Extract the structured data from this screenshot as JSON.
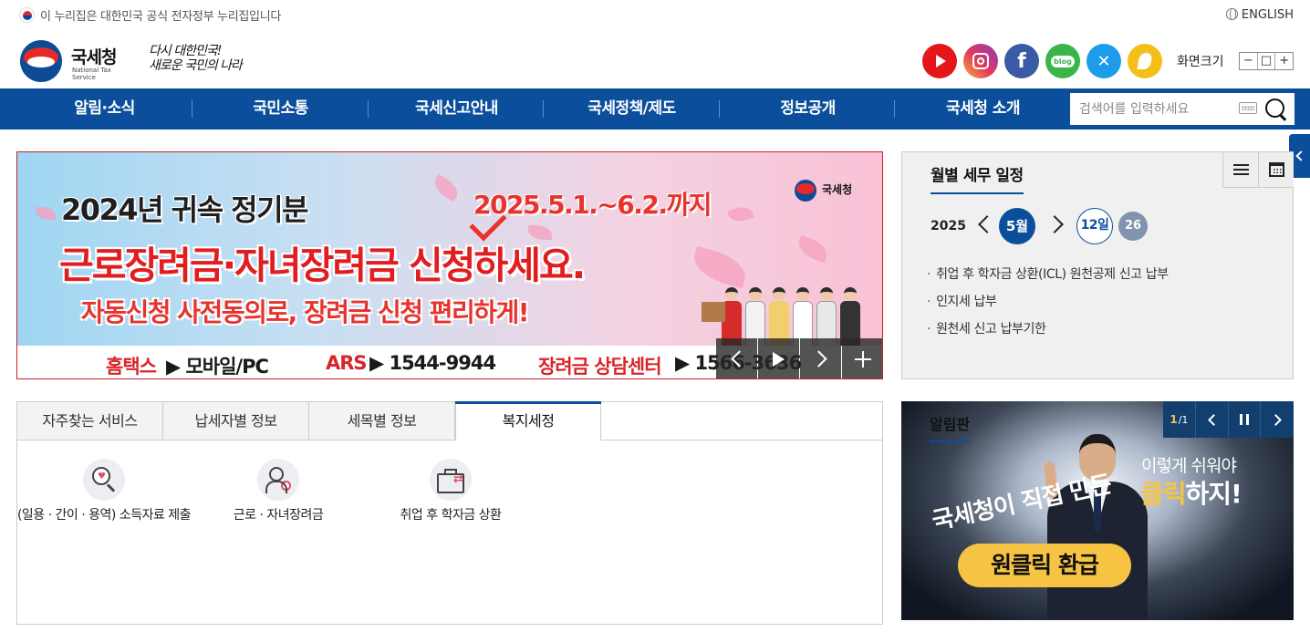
{
  "gov_banner": {
    "text": "이 누리집은 대한민국 공식 전자정부 누리집입니다"
  },
  "language": {
    "label": "ENGLISH"
  },
  "logo": {
    "name": "국세청",
    "english": "National Tax Service",
    "slogan_line1": "다시 대한민국!",
    "slogan_line2": "새로운 국민의 나라"
  },
  "sns": {
    "blog_label": "blog"
  },
  "zoom": {
    "label": "화면크기",
    "minus": "−",
    "reset": "□",
    "plus": "+"
  },
  "gnb": {
    "items": [
      "알림·소식",
      "국민소통",
      "국세신고안내",
      "국세정책/제도",
      "정보공개",
      "국세청 소개"
    ]
  },
  "search": {
    "placeholder": "검색어를 입력하세요"
  },
  "banner": {
    "line1": "2024년 귀속 정기분",
    "date": "2025.5.1.~6.2.까지",
    "line2": "근로장려금·자녀장려금 신청하세요.",
    "line3": "자동신청 사전동의로, 장려금 신청 편리하게!",
    "hometax": "홈택스",
    "hometax_value": "▶ 모바일/PC",
    "ars": "ARS",
    "ars_value": "▶ 1544-9944",
    "center": "장려금 상담센터",
    "center_value": "▶ 1566-3636",
    "logo_text": "국세청"
  },
  "schedule": {
    "title": "월별 세무 일정",
    "year": "2025",
    "month": "5월",
    "selected_day": "12일",
    "other_day": "26",
    "items": [
      "취업 후 학자금 상환(ICL) 원천공제 신고 납부",
      "인지세 납부",
      "원천세 신고 납부기한"
    ]
  },
  "service_tabs": {
    "tabs": [
      "자주찾는 서비스",
      "납세자별 정보",
      "세목별 정보",
      "복지세정"
    ],
    "active_index": 3,
    "services": [
      {
        "label": "(일용 · 간이 · 용역) 소득자료 제출",
        "icon": "magnifier-heart-icon"
      },
      {
        "label": "근로 · 자녀장려금",
        "icon": "users-icon"
      },
      {
        "label": "취업 후 학자금 상환",
        "icon": "briefcase-exchange-icon"
      }
    ]
  },
  "notice": {
    "title": "알림판",
    "page_current": "1",
    "page_total": "/1",
    "text1": "이렇게 쉬워야",
    "text2_hl": "클릭",
    "text2_rest": "하지!",
    "text3": "국세청이 직접 만든",
    "pill": "원클릭 환급"
  },
  "colors": {
    "primary": "#0b4f9c",
    "accent_red": "#e21d1f",
    "accent_yellow": "#f6c343"
  }
}
